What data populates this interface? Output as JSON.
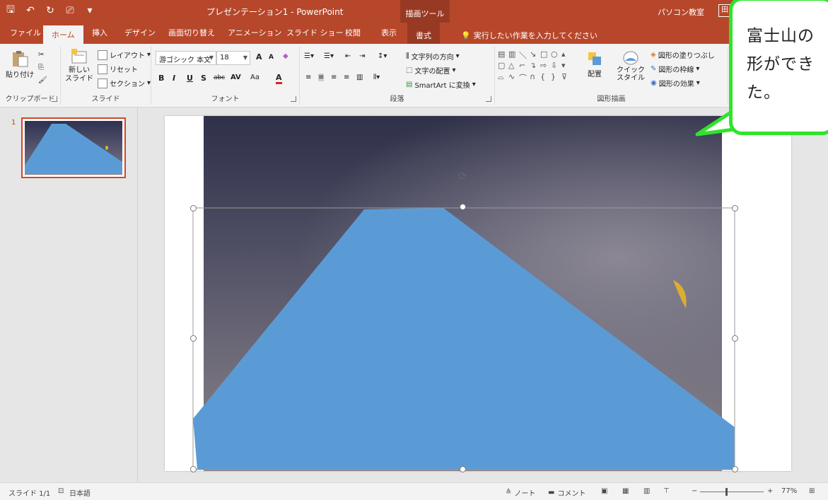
{
  "app": {
    "title": "プレゼンテーション1 - PowerPoint",
    "context_group": "描画ツール",
    "user": "パソコン教室",
    "user_initial": "田"
  },
  "tabs": [
    {
      "label": "ファイル"
    },
    {
      "label": "ホーム"
    },
    {
      "label": "挿入"
    },
    {
      "label": "デザイン"
    },
    {
      "label": "画面切り替え"
    },
    {
      "label": "アニメーション"
    },
    {
      "label": "スライド ショー"
    },
    {
      "label": "校閲"
    },
    {
      "label": "表示"
    },
    {
      "label": "書式"
    }
  ],
  "tellme": "実行したい作業を入力してください",
  "ribbon": {
    "clipboard": {
      "label": "クリップボード",
      "paste": "貼り付け"
    },
    "slides": {
      "label": "スライド",
      "new_slide": "新しい",
      "new_slide2": "スライド",
      "layout": "レイアウト",
      "reset": "リセット",
      "section": "セクション"
    },
    "font": {
      "label": "フォント",
      "font_name": "游ゴシック 本文",
      "font_size": "18",
      "bold": "B",
      "italic": "I",
      "underline": "U",
      "strike": "S",
      "abc": "abc",
      "av": "AV",
      "aa": "Aa",
      "a": "A",
      "grow": "A",
      "shrink": "A"
    },
    "paragraph": {
      "label": "段落",
      "text_direction": "文字列の方向",
      "align_text": "文字の配置",
      "smartart": "SmartArt に変換"
    },
    "drawing": {
      "label": "図形描画",
      "arrange": "配置",
      "quick_style": "クイック",
      "quick_style2": "スタイル",
      "fill": "図形の塗りつぶし",
      "outline": "図形の枠線",
      "effects": "図形の効果"
    }
  },
  "thumbnails": [
    {
      "number": "1"
    }
  ],
  "status": {
    "slide": "スライド 1/1",
    "language": "日本語",
    "notes": "ノート",
    "comments": "コメント",
    "zoom": "77%"
  },
  "callout": {
    "line1": "富士山の",
    "line2": "形ができ",
    "line3": "た。"
  },
  "colors": {
    "ppt_orange": "#b7472a",
    "shape_fill": "#5b9bd5",
    "callout_border": "#2fe42b"
  }
}
